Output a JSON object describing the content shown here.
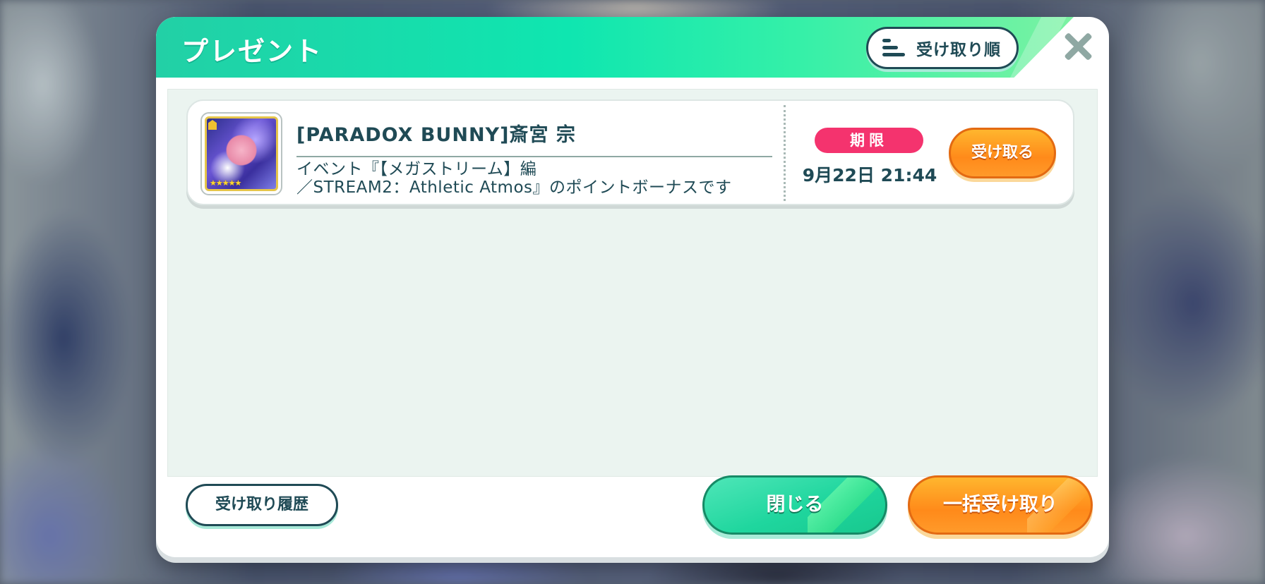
{
  "dialog": {
    "title": "プレゼント",
    "sort_label": "受け取り順"
  },
  "items": [
    {
      "name": "[PARADOX BUNNY]斎宮 宗",
      "description_line1": "イベント『【メガストリーム】編",
      "description_line2": "／STREAM2：Athletic Atmos』のポイントボーナスです",
      "limit_label": "期限",
      "limit_date": "9月22日 21:44",
      "receive_label": "受け取る",
      "rarity_stars": "★★★★★"
    }
  ],
  "footer": {
    "history_label": "受け取り履歴",
    "close_label": "閉じる",
    "bulk_receive_label": "一括受け取り"
  },
  "colors": {
    "header_accent": "#0fe6b0",
    "receive_orange": "#ff8a1a",
    "limit_pink": "#f4336e",
    "text_dark": "#1f4a55"
  },
  "icons": [
    "sort-icon",
    "close-icon",
    "card-thumbnail"
  ]
}
